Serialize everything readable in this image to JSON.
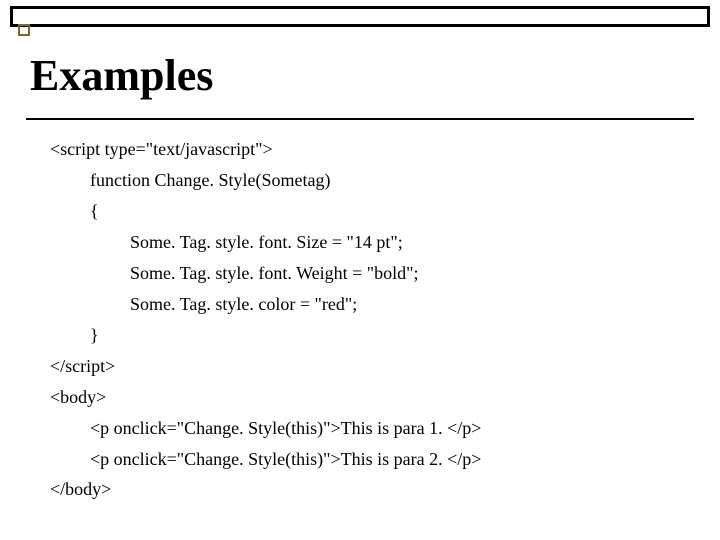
{
  "title": "Examples",
  "code": {
    "l1": "<script type=\"text/javascript\">",
    "l2": "function Change. Style(Sometag)",
    "l3": "{",
    "l4": "Some. Tag. style. font. Size = \"14 pt\";",
    "l5": "Some. Tag. style. font. Weight = \"bold\";",
    "l6": "Some. Tag. style. color = \"red\";",
    "l7": "}",
    "l8": "</script>",
    "l9": "<body>",
    "l10": "<p onclick=\"Change. Style(this)\">This is para 1. </p>",
    "l11": "<p onclick=\"Change. Style(this)\">This is para 2. </p>",
    "l12": "</body>"
  }
}
